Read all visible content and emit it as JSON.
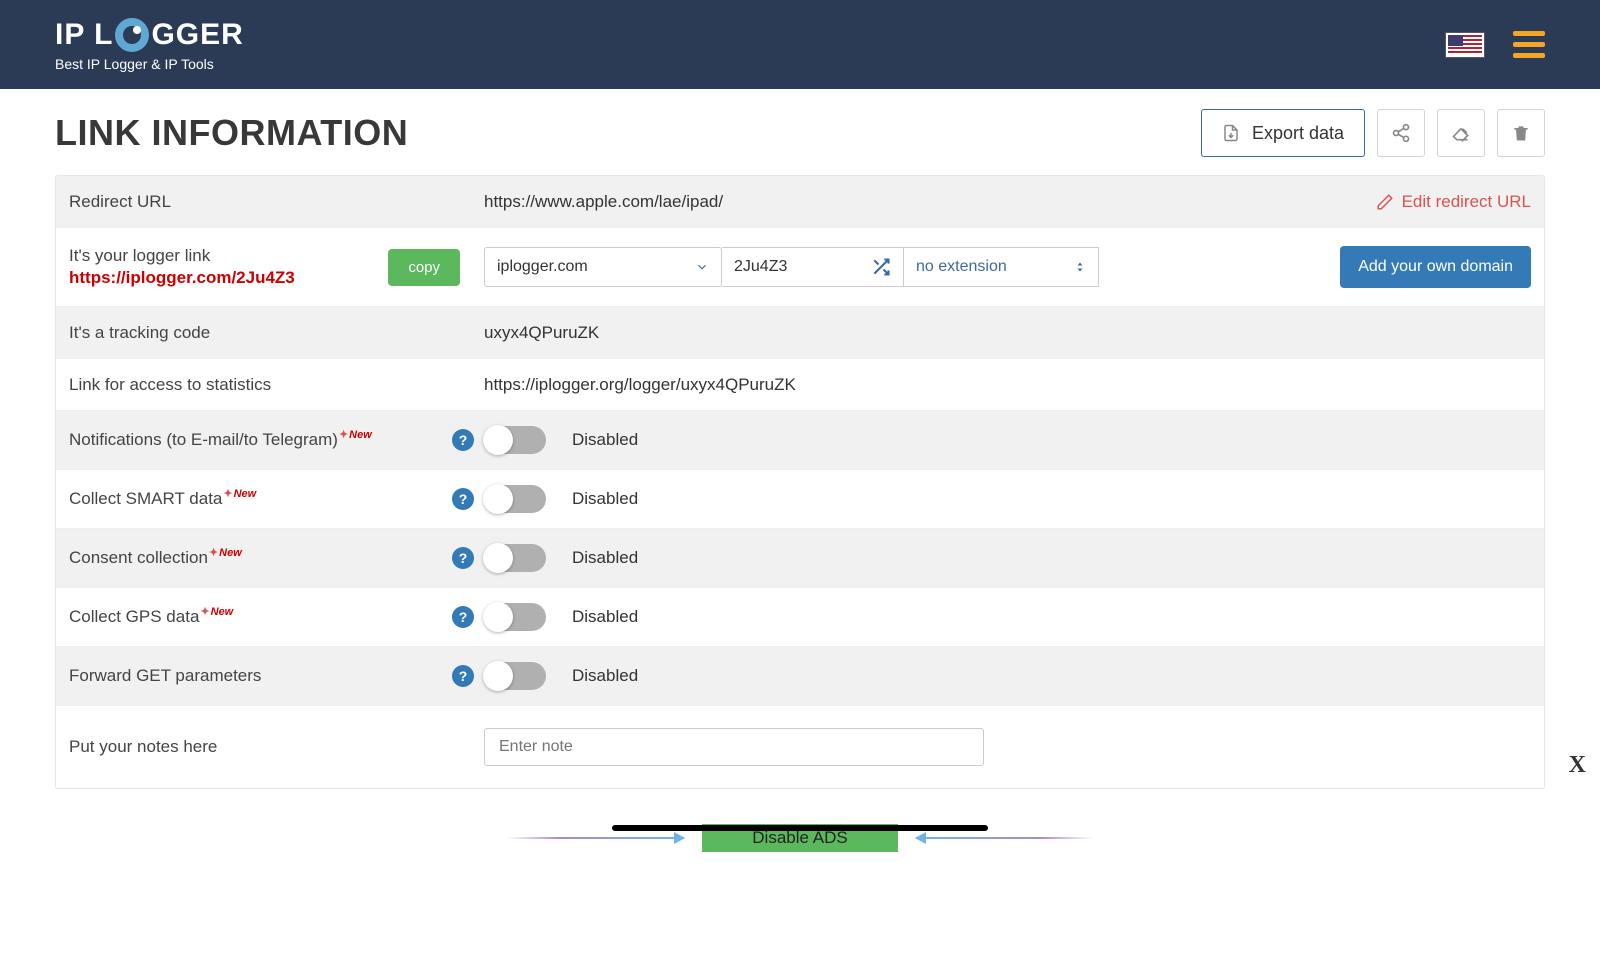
{
  "header": {
    "logo_text_before": "IP L",
    "logo_text_after": "GGER",
    "tagline": "Best IP Logger & IP Tools"
  },
  "page": {
    "title": "LINK INFORMATION",
    "export_label": "Export data"
  },
  "rows": {
    "redirect_label": "Redirect URL",
    "redirect_value": "https://www.apple.com/lae/ipad/",
    "edit_redirect": "Edit redirect URL",
    "logger_label": "It's your logger link",
    "logger_link": "https://iplogger.com/2Ju4Z3",
    "copy": "copy",
    "domain_selected": "iplogger.com",
    "short_code": "2Ju4Z3",
    "extension": "no extension",
    "add_domain": "Add your own domain",
    "tracking_label": "It's a tracking code",
    "tracking_value": "uxyx4QPuruZK",
    "stats_label": "Link for access to statistics",
    "stats_value": "https://iplogger.org/logger/uxyx4QPuruZK",
    "notifications_label": "Notifications (to E-mail/to Telegram)",
    "smart_label": "Collect SMART data",
    "consent_label": "Consent collection",
    "gps_label": "Collect GPS data",
    "forward_label": "Forward GET parameters",
    "disabled": "Disabled",
    "new_badge": "New",
    "notes_label": "Put your notes here",
    "notes_placeholder": "Enter note"
  },
  "ads": {
    "disable_label": "Disable ADS"
  },
  "misc": {
    "close": "X"
  }
}
